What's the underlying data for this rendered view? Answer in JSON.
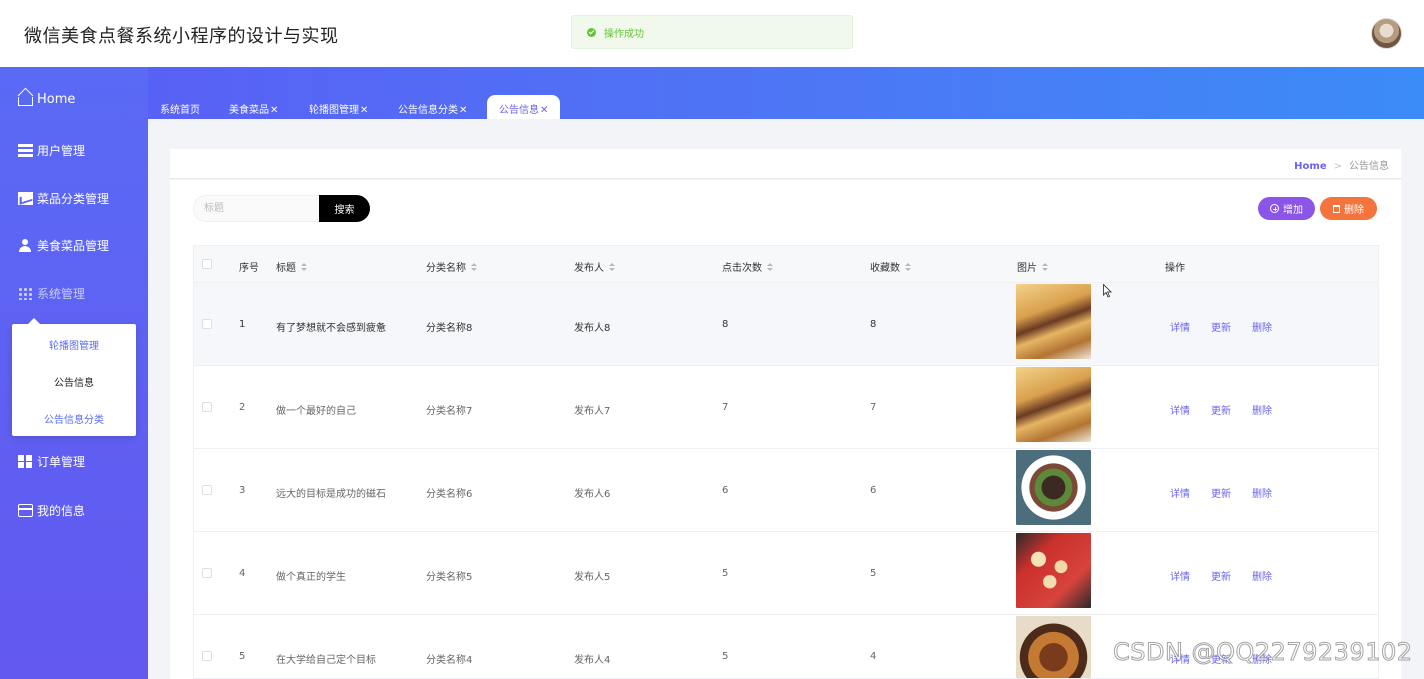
{
  "header": {
    "app_title": "微信美食点餐系统小程序的设计与实现",
    "toast": "操作成功"
  },
  "sidebar": {
    "items": [
      {
        "label": "Home",
        "icon": "home-icon"
      },
      {
        "label": "用户管理",
        "icon": "list-icon"
      },
      {
        "label": "菜品分类管理",
        "icon": "chart-icon"
      },
      {
        "label": "美食菜品管理",
        "icon": "user-icon"
      },
      {
        "label": "系统管理",
        "icon": "grid-icon"
      },
      {
        "label": "订单管理",
        "icon": "apps-icon"
      },
      {
        "label": "我的信息",
        "icon": "card-icon"
      }
    ],
    "submenu": [
      {
        "label": "轮播图管理"
      },
      {
        "label": "公告信息"
      },
      {
        "label": "公告信息分类"
      }
    ]
  },
  "tabs": [
    {
      "label": "系统首页",
      "close": ""
    },
    {
      "label": "美食菜品",
      "close": "✕"
    },
    {
      "label": "轮播图管理",
      "close": "✕"
    },
    {
      "label": "公告信息分类",
      "close": "✕"
    },
    {
      "label": "公告信息",
      "close": "✕"
    }
  ],
  "breadcrumb": {
    "home": "Home",
    "separator": ">",
    "current": "公告信息"
  },
  "toolbar": {
    "search_placeholder": "标题",
    "search_label": "搜索",
    "add_label": "增加",
    "delete_label": "删除"
  },
  "table": {
    "columns": [
      "序号",
      "标题",
      "分类名称",
      "发布人",
      "点击次数",
      "收藏数",
      "图片",
      "操作"
    ],
    "actions": [
      "详情",
      "更新",
      "删除"
    ],
    "rows": [
      {
        "index": "1",
        "title": "有了梦想就不会感到疲惫",
        "category": "分类名称8",
        "publisher": "发布人8",
        "clicks": "8",
        "favorites": "8",
        "image": "food-crepe"
      },
      {
        "index": "2",
        "title": "做一个最好的自己",
        "category": "分类名称7",
        "publisher": "发布人7",
        "clicks": "7",
        "favorites": "7",
        "image": "food-crepe"
      },
      {
        "index": "3",
        "title": "远大的目标是成功的磁石",
        "category": "分类名称6",
        "publisher": "发布人6",
        "clicks": "6",
        "favorites": "6",
        "image": "food-stirfry"
      },
      {
        "index": "4",
        "title": "做个真正的学生",
        "category": "分类名称5",
        "publisher": "发布人5",
        "clicks": "5",
        "favorites": "5",
        "image": "food-dumplings"
      },
      {
        "index": "5",
        "title": "在大学给自己定个目标",
        "category": "分类名称4",
        "publisher": "发布人4",
        "clicks": "5",
        "favorites": "4",
        "image": "food-stew"
      }
    ]
  },
  "watermark": "CSDN @QQ2279239102",
  "colors": {
    "accent": "#6b63ee",
    "sidebar": "#5a6af5",
    "add_button": "#8b55e8",
    "delete_button": "#f5733d",
    "success": "#67c23a"
  }
}
